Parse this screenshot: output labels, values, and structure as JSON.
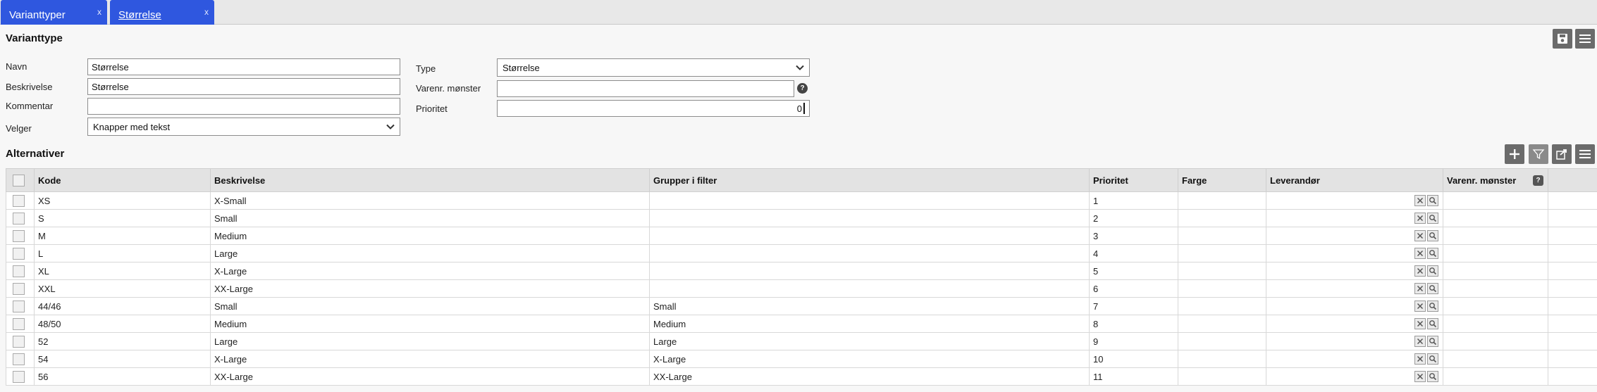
{
  "tabs": [
    {
      "label": "Varianttyper",
      "close": "x"
    },
    {
      "label": "Størrelse",
      "close": "x"
    }
  ],
  "form": {
    "title": "Varianttype",
    "navn_label": "Navn",
    "navn_value": "Størrelse",
    "beskrivelse_label": "Beskrivelse",
    "beskrivelse_value": "Størrelse",
    "kommentar_label": "Kommentar",
    "kommentar_value": "",
    "velger_label": "Velger",
    "velger_value": "Knapper med tekst",
    "type_label": "Type",
    "type_value": "Størrelse",
    "varenr_label": "Varenr. mønster",
    "varenr_value": "",
    "prioritet_label": "Prioritet",
    "prioritet_value": "0",
    "help_glyph": "?"
  },
  "alternatives": {
    "title": "Alternativer",
    "columns": {
      "kode": "Kode",
      "beskrivelse": "Beskrivelse",
      "grupper": "Grupper i filter",
      "prioritet": "Prioritet",
      "farge": "Farge",
      "leverandor": "Leverandør",
      "varenr": "Varenr. mønster"
    },
    "rows": [
      {
        "kode": "XS",
        "beskrivelse": "X-Small",
        "grupper": "",
        "prioritet": "1"
      },
      {
        "kode": "S",
        "beskrivelse": "Small",
        "grupper": "",
        "prioritet": "2"
      },
      {
        "kode": "M",
        "beskrivelse": "Medium",
        "grupper": "",
        "prioritet": "3"
      },
      {
        "kode": "L",
        "beskrivelse": "Large",
        "grupper": "",
        "prioritet": "4"
      },
      {
        "kode": "XL",
        "beskrivelse": "X-Large",
        "grupper": "",
        "prioritet": "5"
      },
      {
        "kode": "XXL",
        "beskrivelse": "XX-Large",
        "grupper": "",
        "prioritet": "6"
      },
      {
        "kode": "44/46",
        "beskrivelse": "Small",
        "grupper": "Small",
        "prioritet": "7"
      },
      {
        "kode": "48/50",
        "beskrivelse": "Medium",
        "grupper": "Medium",
        "prioritet": "8"
      },
      {
        "kode": "52",
        "beskrivelse": "Large",
        "grupper": "Large",
        "prioritet": "9"
      },
      {
        "kode": "54",
        "beskrivelse": "X-Large",
        "grupper": "X-Large",
        "prioritet": "10"
      },
      {
        "kode": "56",
        "beskrivelse": "XX-Large",
        "grupper": "XX-Large",
        "prioritet": "11"
      }
    ]
  },
  "icons": {
    "save": "save-icon",
    "menu": "menu-icon",
    "add": "plus-icon",
    "filter": "filter-icon",
    "export": "export-icon",
    "clear": "clear-icon",
    "search": "search-icon"
  },
  "colors": {
    "tab_active": "#2f57df",
    "toolbar_button": "#6b6b6b",
    "header_bg": "#e3e3e3"
  }
}
